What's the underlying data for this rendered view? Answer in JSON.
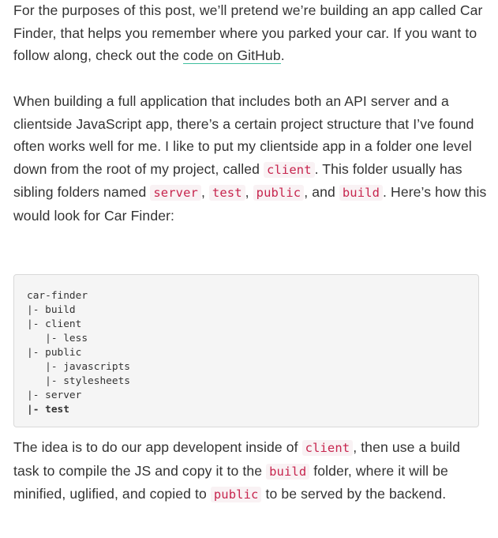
{
  "paragraph1": {
    "text_before_link": "For the purposes of this post, we’ll pretend we’re building an app called Car Finder, that helps you remember where you parked your car. If you want to follow along, check out the ",
    "link_text": "code on GitHub",
    "text_after_link": "."
  },
  "paragraph2": {
    "text1": "When building a full application that includes both an API server and a clientside JavaScript app, there’s a certain project structure that I’ve found often works well for me. I like to put my clientside app in a folder one level down from the root of my project, called ",
    "code1": "client",
    "text2": ". This folder usually has sibling folders named ",
    "code2": "server",
    "text3": ", ",
    "code3": "test",
    "text4": ", ",
    "code4": "public",
    "text5": ", and ",
    "code5": "build",
    "text6": ". Here’s how this would look for Car Finder:"
  },
  "code_block": {
    "lines": [
      "car-finder",
      "|- build",
      "|- client",
      "   |- less",
      "|- public",
      "   |- javascripts",
      "   |- stylesheets",
      "|- server",
      "|- test"
    ]
  },
  "paragraph3": {
    "text1": "The idea is to do our app developent inside of ",
    "code1": "client",
    "text2": ", then use a build task to compile the JS and copy it to the ",
    "code2": "build",
    "text3": " folder, where it will be minified, uglified, and copied to ",
    "code3": "public",
    "text4": " to be served by the backend."
  },
  "colors": {
    "text": "#333333",
    "inline_code": "#c7254e",
    "inline_code_bg": "#f9f2f4",
    "link_underline": "#3fbf9f",
    "code_block_bg": "#f5f5f5"
  }
}
